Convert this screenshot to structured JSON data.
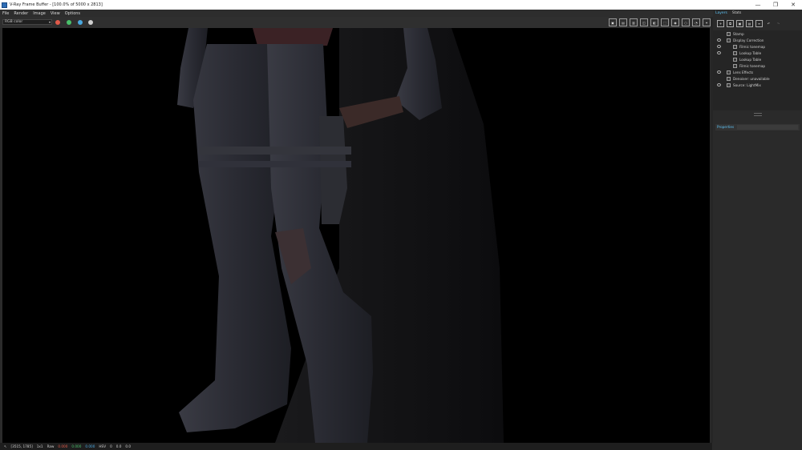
{
  "window": {
    "title": "V-Ray Frame Buffer - [100.0% of 5000 x 2813]",
    "controls": [
      "—",
      "❐",
      "✕"
    ]
  },
  "menu": [
    "File",
    "Render",
    "Image",
    "View",
    "Options"
  ],
  "toolbar": {
    "channel": "RGB color",
    "dots": [
      {
        "name": "red-channel-toggle",
        "color": "#e05a4a"
      },
      {
        "name": "green-channel-toggle",
        "color": "#49c06a"
      },
      {
        "name": "blue-channel-toggle",
        "color": "#4aa8e0"
      },
      {
        "name": "alpha-channel-toggle",
        "color": "#d0d0d0"
      }
    ],
    "icons": [
      "save-icon",
      "save-all-icon",
      "load-icon",
      "ref-icon",
      "compare-icon",
      "region-icon",
      "render-icon",
      "stop-icon",
      "teapot-icon",
      "settings-icon"
    ]
  },
  "panel": {
    "tabs": [
      "Layers",
      "Stats"
    ],
    "tools": [
      "add-layer-icon",
      "duplicate-layer-icon",
      "save-preset-icon",
      "load-preset-icon",
      "list-icon",
      "undo-icon",
      "redo-icon"
    ],
    "layers": [
      {
        "label": "Stamp",
        "eye": false,
        "indent": 0
      },
      {
        "label": "Display Correction",
        "eye": true,
        "indent": 0
      },
      {
        "label": "Filmic tonemap",
        "eye": true,
        "indent": 1
      },
      {
        "label": "Lookup Table",
        "eye": true,
        "indent": 1
      },
      {
        "label": "Lookup Table",
        "eye": false,
        "indent": 1
      },
      {
        "label": "Filmic tonemap",
        "eye": false,
        "indent": 1
      },
      {
        "label": "Lens Effects",
        "eye": true,
        "indent": 0
      },
      {
        "label": "Denoiser: unavailable",
        "eye": false,
        "indent": 0
      },
      {
        "label": "Source: LightMix",
        "eye": true,
        "indent": 0
      }
    ],
    "properties_label": "Properties"
  },
  "status": {
    "coords": "[3515, 1785]",
    "zoom": "1x1",
    "raw": "Raw",
    "r": "0.000",
    "g": "0.000",
    "b": "0.000",
    "hsv": "HSV",
    "h": "0",
    "s": "0.0",
    "v": "0.0"
  }
}
